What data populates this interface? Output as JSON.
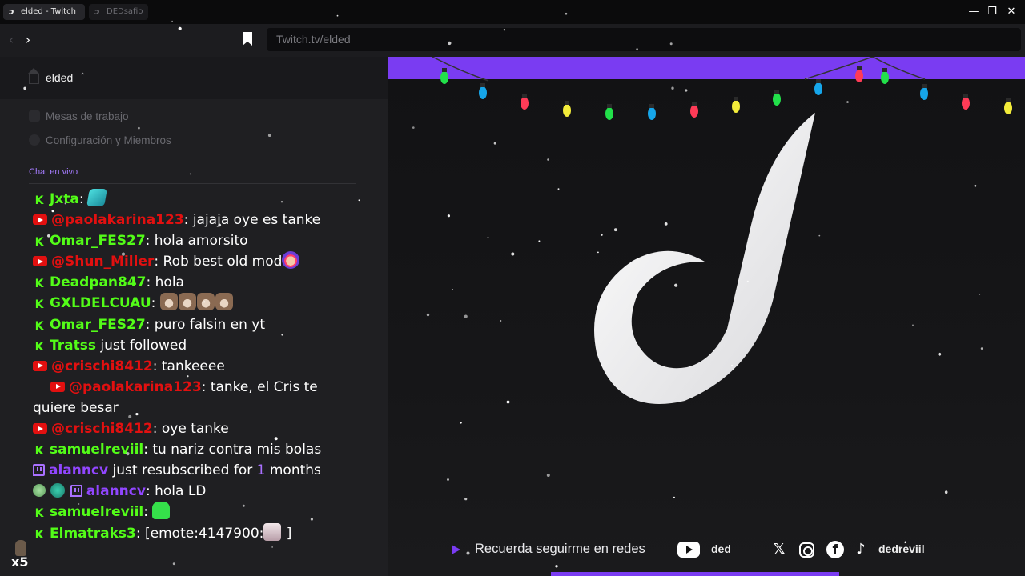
{
  "browser": {
    "tabs": [
      {
        "label": "elded - Twitch",
        "icon": "twitch-d-logo-icon",
        "active": true
      },
      {
        "label": "DEDsafio",
        "icon": "twitch-d-logo-icon",
        "active": false
      }
    ],
    "url": "Twitch.tv/elded",
    "window_controls": [
      "minimize-icon",
      "restore-icon",
      "close-icon"
    ]
  },
  "sidebar": {
    "workspace": "elded",
    "menu": [
      {
        "label": "Mesas de trabajo"
      },
      {
        "label": "Configuración y Miembros"
      }
    ],
    "section_title": "Chat en vivo"
  },
  "chat": {
    "messages": [
      {
        "platform": "kick",
        "user": "Jxta",
        "text": "",
        "emotes": [
          "blue-emote"
        ]
      },
      {
        "platform": "youtube",
        "user": "@paolakarina123",
        "text": "jajaja oye es tanke"
      },
      {
        "platform": "kick",
        "user": "Omar_FES27",
        "text": "hola amorsito"
      },
      {
        "platform": "youtube",
        "user": "@Shun_Miller",
        "text": "Rob best old mod",
        "emotes": [
          "face-emote"
        ]
      },
      {
        "platform": "kick",
        "user": "Deadpan847",
        "text": "hola"
      },
      {
        "platform": "kick",
        "user": "GXLDELCUAU",
        "text": "",
        "emotes": [
          "cat-emote",
          "cat-emote",
          "cat-emote",
          "cat-emote"
        ]
      },
      {
        "platform": "kick",
        "user": "Omar_FES27",
        "text": "puro falsin en yt"
      },
      {
        "platform": "kick",
        "user": "Tratss",
        "event": "just followed"
      },
      {
        "platform": "youtube",
        "user": "@crischi8412",
        "text": "tankeeee"
      },
      {
        "platform": "youtube",
        "user": "@paolakarina123",
        "text": "tanke, el Cris te quiere besar"
      },
      {
        "platform": "youtube",
        "user": "@crischi8412",
        "text": "oye tanke"
      },
      {
        "platform": "kick",
        "user": "samuelreviil",
        "text": "tu nariz contra mis bolas"
      },
      {
        "platform": "twitch",
        "user": "alanncv",
        "event_pre": "just resubscribed for",
        "event_count": "1",
        "event_post": "months"
      },
      {
        "platform": "twitch",
        "user": "alanncv",
        "text": "hola LD",
        "badges": [
          "egg-badge",
          "dino-badge"
        ]
      },
      {
        "platform": "kick",
        "user": "samuelreviil",
        "text": "",
        "emotes": [
          "green-emote"
        ]
      },
      {
        "platform": "kick",
        "user": "Elmatraks3",
        "text": "[emote:4147900:",
        "text_after": "]",
        "emotes": [
          "dog-emote"
        ]
      }
    ],
    "viewer_badge": "x5"
  },
  "stream": {
    "footer_text": "Recuerda seguirme en redes",
    "youtube_handle": "ded",
    "social_handle": "dedreviil",
    "social_icons": [
      "x-icon",
      "instagram-icon",
      "facebook-icon",
      "tiktok-icon"
    ],
    "light_colors": [
      "#22e04a",
      "#16a6ea",
      "#ff3b57",
      "#f3ec3a"
    ]
  },
  "colors": {
    "kick_green": "#53fc18",
    "youtube_red": "#e21010",
    "twitch_purple": "#9146ff",
    "accent_purple": "#7a3cf2"
  }
}
